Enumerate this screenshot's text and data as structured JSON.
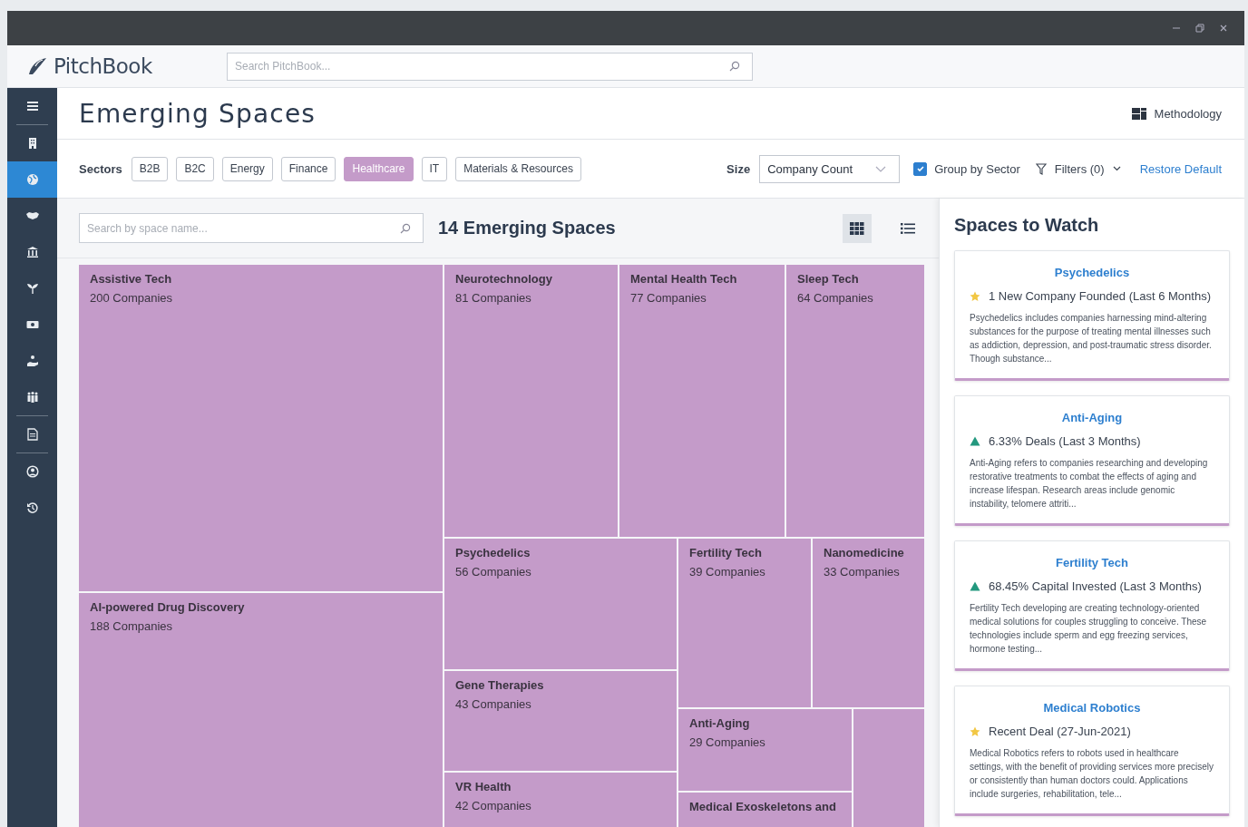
{
  "app": {
    "logo": "PitchBook",
    "search": {
      "placeholder": "Search PitchBook..."
    }
  },
  "sidebar": {
    "items": [
      {
        "selected": false
      },
      {
        "selected": false
      },
      {
        "selected": true
      },
      {
        "selected": false
      },
      {
        "selected": false
      },
      {
        "selected": false
      },
      {
        "selected": false
      },
      {
        "selected": false
      },
      {
        "selected": false
      },
      {
        "selected": false
      },
      {
        "selected": false
      },
      {
        "selected": false
      }
    ]
  },
  "page": {
    "title": "Emerging Spaces",
    "methodology": "Methodology"
  },
  "filters": {
    "sectors_label": "Sectors",
    "sectors": [
      {
        "label": "B2B",
        "selected": false
      },
      {
        "label": "B2C",
        "selected": false
      },
      {
        "label": "Energy",
        "selected": false
      },
      {
        "label": "Finance",
        "selected": false
      },
      {
        "label": "Healthcare",
        "selected": true
      },
      {
        "label": "IT",
        "selected": false
      },
      {
        "label": "Materials & Resources",
        "selected": false
      }
    ],
    "size_label": "Size",
    "size_value": "Company Count",
    "group_by_sector": {
      "label": "Group by Sector",
      "checked": true
    },
    "filters_button": "Filters (0)",
    "restore": "Restore Default"
  },
  "results": {
    "search": {
      "placeholder": "Search by space name..."
    },
    "count_title": "14 Emerging Spaces",
    "views": [
      {
        "kind": "grid",
        "selected": true
      },
      {
        "kind": "list",
        "selected": false
      }
    ]
  },
  "treemap": [
    {
      "name": "Assistive Tech",
      "count": "200 Companies"
    },
    {
      "name": "AI-powered Drug Discovery",
      "count": "188 Companies"
    },
    {
      "name": "Neurotechnology",
      "count": "81 Companies"
    },
    {
      "name": "Mental Health Tech",
      "count": "77 Companies"
    },
    {
      "name": "Sleep Tech",
      "count": "64 Companies"
    },
    {
      "name": "Psychedelics",
      "count": "56 Companies"
    },
    {
      "name": "Fertility Tech",
      "count": "39 Companies"
    },
    {
      "name": "Nanomedicine",
      "count": "33 Companies"
    },
    {
      "name": "Gene Therapies",
      "count": "43 Companies"
    },
    {
      "name": "Anti-Aging",
      "count": "29 Companies"
    },
    {
      "name": "VR Health",
      "count": "42 Companies"
    },
    {
      "name": "Medical Exoskeletons and"
    }
  ],
  "watch": {
    "title": "Spaces to Watch",
    "cards": [
      {
        "title": "Psychedelics",
        "kind": "star",
        "metric": "1 New Company Founded (Last 6 Months)",
        "text": "Psychedelics includes companies harnessing mind-altering substances for the purpose of treating mental illnesses such as addiction, depression, and post-traumatic stress disorder. Though substance..."
      },
      {
        "title": "Anti-Aging",
        "kind": "up",
        "metric": "6.33% Deals (Last 3 Months)",
        "text": "Anti-Aging refers to companies researching and developing restorative treatments to combat the effects of aging and increase lifespan. Research areas include genomic instability, telomere attriti..."
      },
      {
        "title": "Fertility Tech",
        "kind": "up",
        "metric": "68.45% Capital Invested (Last 3 Months)",
        "text": "Fertility Tech developing are creating technology-oriented medical solutions for couples struggling to conceive. These technologies include sperm and egg freezing services, hormone testing..."
      },
      {
        "title": "Medical Robotics",
        "kind": "star",
        "metric": "Recent Deal (27-Jun-2021)",
        "text": "Medical Robotics refers to robots used in healthcare settings, with the benefit of providing services more precisely or consistently than human doctors could. Applications include surgeries, rehabilitation, tele..."
      }
    ]
  }
}
